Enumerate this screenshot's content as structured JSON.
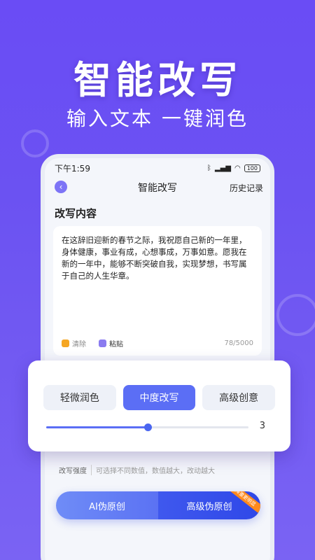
{
  "hero": {
    "title": "智能改写",
    "subtitle": "输入文本 一键润色"
  },
  "status_bar": {
    "time": "下午1:59",
    "battery": "100"
  },
  "nav": {
    "back_icon": "chevron-left-icon",
    "title": "智能改写",
    "history": "历史记录"
  },
  "editor": {
    "section_title": "改写内容",
    "content": "在这辞旧迎新的春节之际，我祝愿自己新的一年里，身体健康，事业有成，心想事成，万事如意。愿我在新的一年中，能够不断突破自我，实现梦想，书写属于自己的人生华章。",
    "clear_label": "清除",
    "paste_label": "粘贴",
    "counter": "78/5000"
  },
  "modes": {
    "options": [
      "轻微润色",
      "中度改写",
      "高级创意"
    ],
    "selected": "中度改写"
  },
  "slider": {
    "fraction": 0.5,
    "value": "3"
  },
  "strength": {
    "label": "改写强度",
    "hint": "可选择不同数值，数值越大，改动越大"
  },
  "actions": {
    "ai_label": "AI伪原创",
    "advanced_label": "高级伪原创",
    "ribbon": "降重更明显"
  },
  "colors": {
    "accent": "#5b6ef5",
    "background": "#6a4cf5"
  }
}
